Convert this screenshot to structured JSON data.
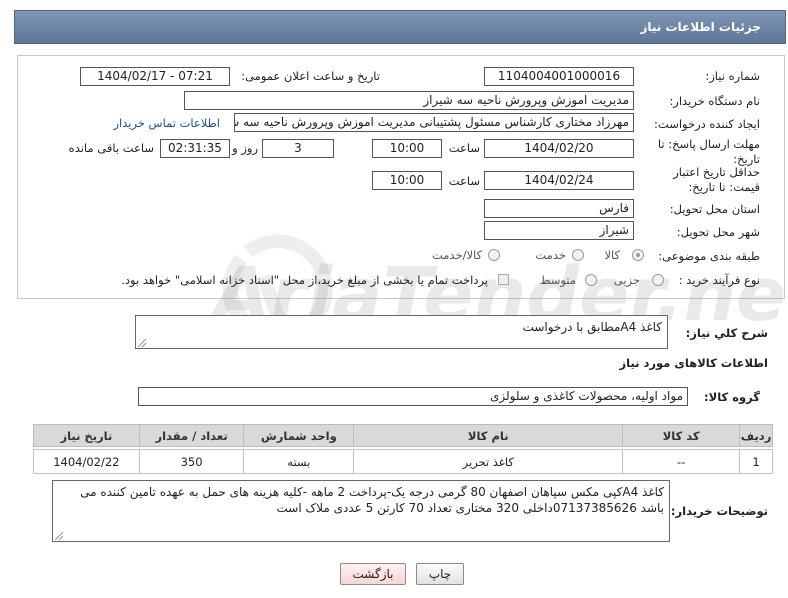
{
  "header": {
    "title": "جزئیات اطلاعات نیاز"
  },
  "form": {
    "need_number_label": "شماره نیاز:",
    "need_number": "1104004001000016",
    "announce_label": "تاریخ و ساعت اعلان عمومی:",
    "announce_value": "1404/02/17 - 07:21",
    "buyer_org_label": "نام دستگاه خریدار:",
    "buyer_org": "مدیریت اموزش وپرورش ناحیه سه شیراز",
    "creator_label": "ایجاد کننده درخواست:",
    "creator": "مهرزاد مختاری کارشناس مسئول پشتیبانی مدیریت اموزش وپرورش ناحیه سه شیراز",
    "contact_link": "اطلاعات تماس خریدار",
    "reply_deadline_label": "مهلت ارسال پاسخ: تا تاریخ:",
    "reply_date": "1404/02/20",
    "time_label": "ساعت",
    "reply_time": "10:00",
    "days_value": "3",
    "days_label": "روز و",
    "remaining_value": "02:31:35",
    "remaining_label": "ساعت باقی مانده",
    "price_deadline_label": "حداقل تاریخ اعتبار قیمت: تا تاریخ:",
    "price_date": "1404/02/24",
    "price_time": "10:00",
    "province_label": "استان محل تحویل:",
    "province": "فارس",
    "city_label": "شهر محل تحویل:",
    "city": "شیراز",
    "category_label": "طبقه بندی موضوعی:",
    "category_options": [
      "کالا",
      "خدمت",
      "کالا/خدمت"
    ],
    "category_selected": "کالا",
    "process_label": "نوع فرآیند خرید :",
    "process_options": [
      "جزیی",
      "متوسط"
    ],
    "process_note": "پرداخت تمام یا بخشی از مبلغ خرید،از محل \"اسناد خزانه اسلامی\" خواهد بود."
  },
  "summary": {
    "label": "شرح کلي نياز:",
    "value": "کاغذ A4مطابق با درخواست"
  },
  "goods_section": {
    "title": "اطلاعات کالاهای مورد نیاز",
    "group_label": "گروه کالا:",
    "group_value": "مواد اولیه، محصولات کاغذی و سلولزی"
  },
  "table": {
    "headers": [
      "ردیف",
      "کد کالا",
      "نام کالا",
      "واحد شمارش",
      "تعداد / مقدار",
      "تاریخ نیاز"
    ],
    "rows": [
      [
        "1",
        "--",
        "کاغذ تحریر",
        "بسته",
        "350",
        "1404/02/22"
      ]
    ]
  },
  "buyer_notes": {
    "label": "توضیحات خریدار:",
    "value": "کاغذ A4کپی مکس سپاهان اصفهان 80 گرمی درجه یک-پرداخت 2 ماهه -کلیه هزینه های حمل به عهده تامین کننده می باشد 07137385626داخلی 320 مختاری تعداد 70 کارتن 5 عددی ملاک است"
  },
  "buttons": {
    "print": "چاپ",
    "back": "بازگشت"
  },
  "watermark": {
    "text": "AriaTender.neT"
  }
}
